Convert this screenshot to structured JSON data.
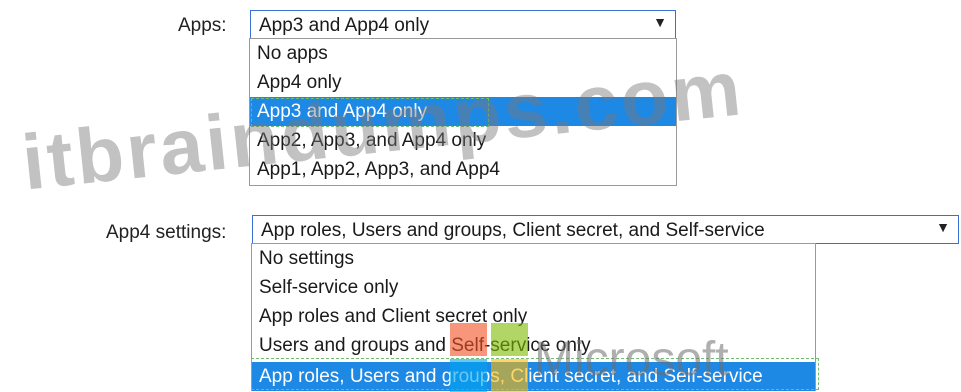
{
  "apps": {
    "label": "Apps:",
    "selected": "App3 and App4 only",
    "options": [
      "No apps",
      "App4 only",
      "App3 and App4 only",
      "App2, App3, and App4 only",
      "App1, App2, App3, and App4"
    ]
  },
  "app4_settings": {
    "label": "App4 settings:",
    "selected": "App roles, Users and groups, Client secret, and Self-service",
    "options": [
      "No settings",
      "Self-service only",
      "App roles and Client secret only",
      "Users and groups and Self-service only",
      "App roles, Users and groups, Client secret, and Self-service"
    ]
  },
  "watermark": "itbraindumps.com",
  "brand": "Microsoft",
  "colors": {
    "selection": "#1e88e5",
    "focus_border": "#3a6fd8",
    "ms_red": "#f25022",
    "ms_green": "#7fba00",
    "ms_blue": "#00a4ef",
    "ms_yellow": "#ffb900"
  },
  "icons": {
    "dropdown": "triangle-down-icon"
  }
}
